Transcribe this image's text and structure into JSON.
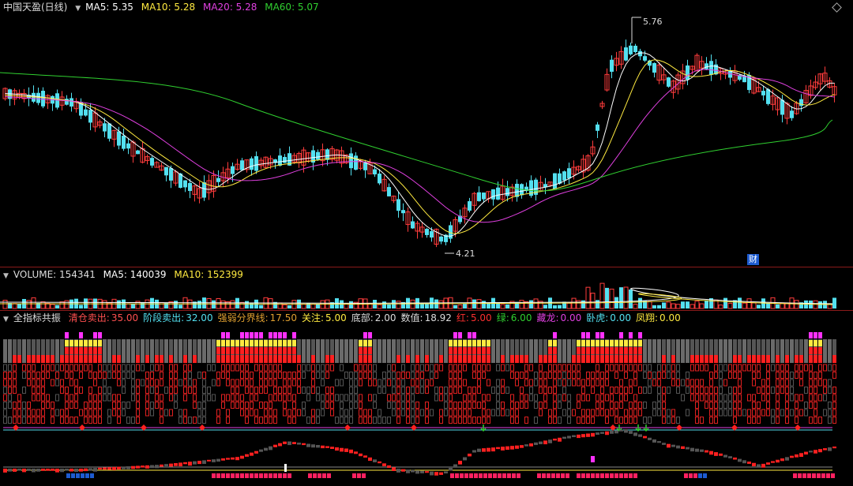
{
  "main": {
    "title": "中国天盈(日线)",
    "ma5_label": "MA5: 5.35",
    "ma10_label": "MA10: 5.28",
    "ma20_label": "MA20: 5.28",
    "ma60_label": "MA60: 5.07",
    "high_label": "5.76",
    "low_label": "4.21",
    "cai_label": "财",
    "colors": {
      "up": "#ff3c3c",
      "down": "#53e0f0",
      "ma5": "#ffffff",
      "ma10": "#ffea40",
      "ma20": "#e040e0",
      "ma60": "#30d030"
    }
  },
  "volume": {
    "volume_label": "VOLUME: 154341",
    "ma5_label": "MA5: 140039",
    "ma10_label": "MA10: 152399"
  },
  "indicator": {
    "name": "全指标共振",
    "items": [
      {
        "label": "清仓卖出:",
        "value": "35.00",
        "color": "#ff5050"
      },
      {
        "label": "阶段卖出:",
        "value": "32.00",
        "color": "#53e0f0"
      },
      {
        "label": "强弱分界线:",
        "value": "17.50",
        "color": "#e0a030"
      },
      {
        "label": "关注:",
        "value": "5.00",
        "color": "#ffea40"
      },
      {
        "label": "底部:",
        "value": "2.00",
        "color": "#dddddd"
      },
      {
        "label": "数值:",
        "value": "18.92",
        "color": "#dddddd"
      },
      {
        "label": "红:",
        "value": "5.00",
        "color": "#ff3030"
      },
      {
        "label": "绿:",
        "value": "6.00",
        "color": "#30d030"
      },
      {
        "label": "藏龙:",
        "value": "0.00",
        "color": "#e040e0"
      },
      {
        "label": "卧虎:",
        "value": "0.00",
        "color": "#53e0f0"
      },
      {
        "label": "凤翔:",
        "value": "0.00",
        "color": "#ffea40"
      }
    ]
  }
}
